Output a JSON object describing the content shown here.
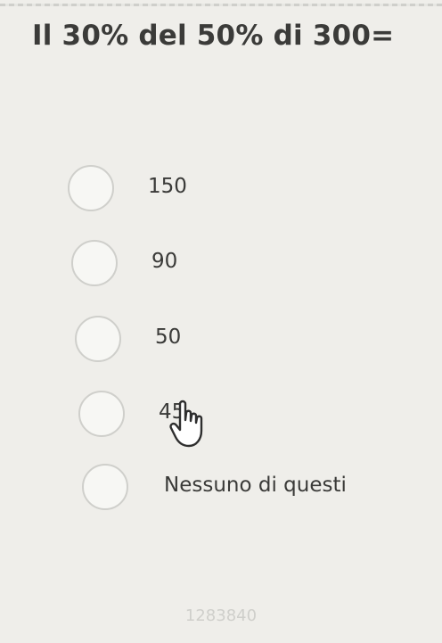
{
  "question": {
    "text": "Il 30% del 50% di 300="
  },
  "options": [
    {
      "label": "150"
    },
    {
      "label": "90"
    },
    {
      "label": "50"
    },
    {
      "label": "45"
    },
    {
      "label": "Nessuno di questi"
    }
  ],
  "cursor": {
    "icon": "pointing-hand-icon"
  },
  "footer": {
    "id": "1283840"
  }
}
